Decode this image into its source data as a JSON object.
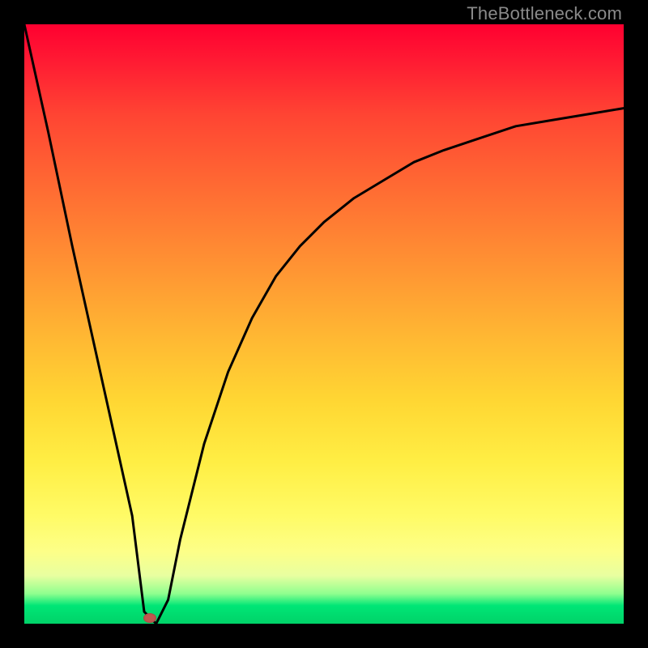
{
  "watermark": "TheBottleneck.com",
  "colors": {
    "frame": "#000000",
    "curve": "#000000",
    "marker": "#c0574f"
  },
  "chart_data": {
    "type": "line",
    "title": "",
    "xlabel": "",
    "ylabel": "",
    "xlim": [
      0,
      100
    ],
    "ylim": [
      0,
      100
    ],
    "grid": false,
    "legend": false,
    "note": "Axes unlabeled; values are relative percentages estimated from pixel positions (0 at bottom-left, 100 at top-right).",
    "x": [
      0,
      4,
      8,
      12,
      16,
      18,
      20,
      22,
      24,
      26,
      30,
      34,
      38,
      42,
      46,
      50,
      55,
      60,
      65,
      70,
      76,
      82,
      88,
      94,
      100
    ],
    "y": [
      100,
      82,
      63,
      45,
      27,
      18,
      2,
      0,
      4,
      14,
      30,
      42,
      51,
      58,
      63,
      67,
      71,
      74,
      77,
      79,
      81,
      83,
      84,
      85,
      86
    ],
    "marker": {
      "x": 21,
      "y": 1
    }
  }
}
